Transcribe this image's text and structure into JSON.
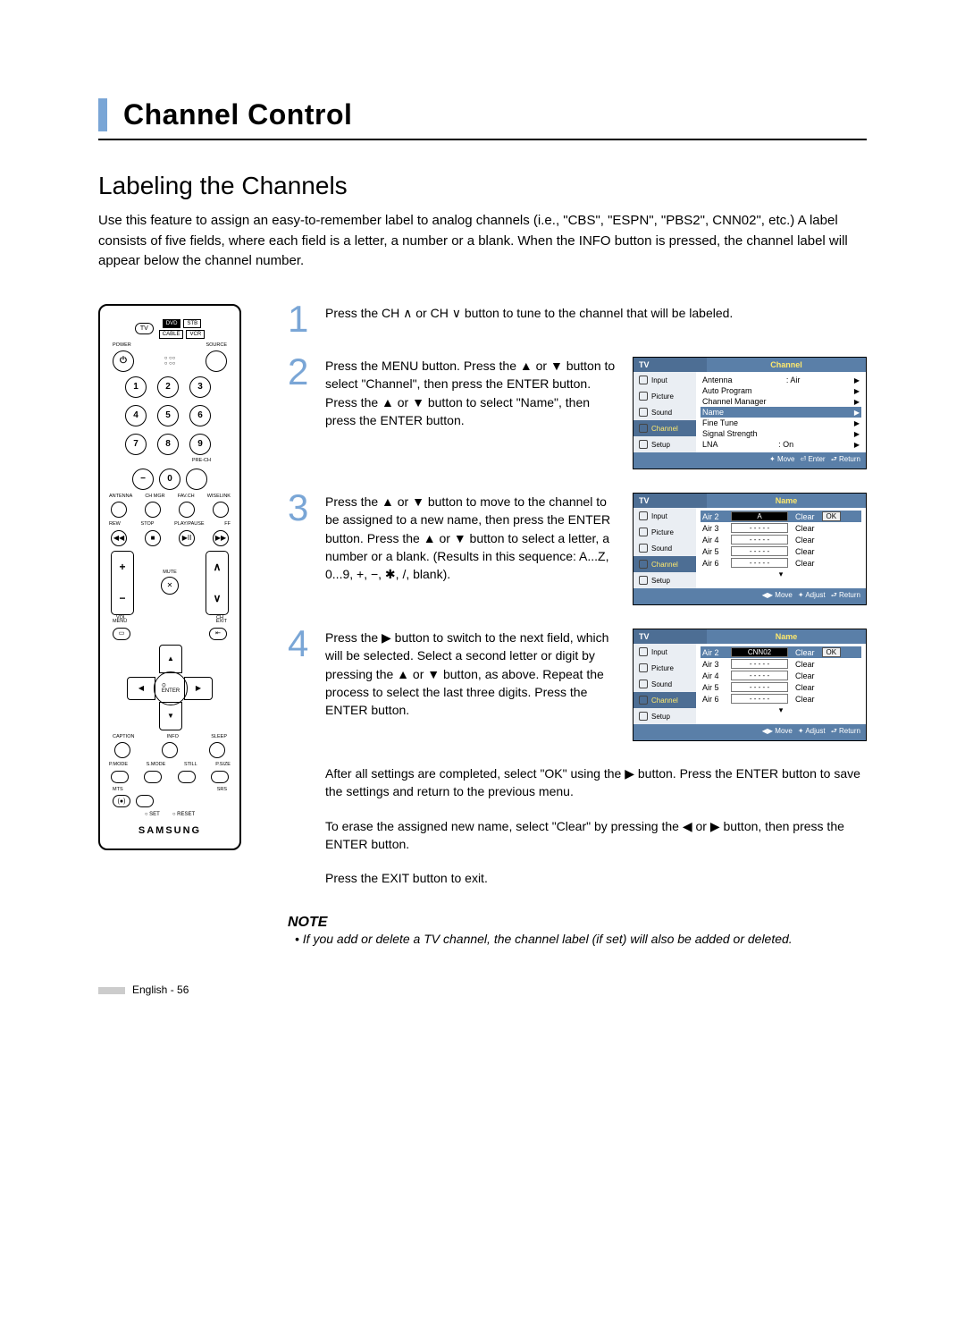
{
  "header": {
    "title": "Channel Control"
  },
  "section": {
    "title": "Labeling the Channels"
  },
  "intro": "Use this feature to assign an easy-to-remember label to analog channels (i.e., \"CBS\", \"ESPN\", \"PBS2\", CNN02\", etc.) A label consists of five fields, where each field is a letter, a number or a blank. When the INFO button is pressed, the channel label will appear below the channel number.",
  "steps": {
    "s1": "Press the CH ∧ or CH ∨ button to tune to the channel that will be labeled.",
    "s2": "Press the MENU button. Press the ▲ or ▼ button to select \"Channel\", then press the ENTER button. Press the ▲ or ▼ button to select \"Name\", then press the ENTER button.",
    "s3": "Press the ▲ or ▼ button to move to the channel to be assigned to a new name, then press the ENTER button. Press the ▲ or ▼ button to select a letter, a number or a blank. (Results in this sequence: A...Z, 0...9, +, −, ✱, /, blank).",
    "s4": "Press the ▶ button to switch to the next field, which will be selected. Select a second letter or digit by pressing the ▲ or ▼ button, as above. Repeat the process to select the last three digits. Press the ENTER button.",
    "after1": "After all settings are completed, select \"OK\" using the ▶ button. Press the ENTER button to save the settings and return to the previous menu.",
    "after2": "To erase the assigned new name, select \"Clear\" by pressing the ◀ or ▶ button, then press the ENTER button.",
    "after3": "Press the EXIT button to exit."
  },
  "note": {
    "head": "NOTE",
    "body": "• If you add or delete a TV channel, the channel label (if set) will also be added or deleted."
  },
  "footer": "English - 56",
  "osd": {
    "tv": "TV",
    "side": [
      "Input",
      "Picture",
      "Sound",
      "Channel",
      "Setup"
    ],
    "channel": {
      "title": "Channel",
      "rows": [
        {
          "l": "Antenna",
          "r": ": Air"
        },
        {
          "l": "Auto Program",
          "r": ""
        },
        {
          "l": "Channel Manager",
          "r": ""
        },
        {
          "l": "Name",
          "r": ""
        },
        {
          "l": "Fine Tune",
          "r": ""
        },
        {
          "l": "Signal Strength",
          "r": ""
        },
        {
          "l": "LNA",
          "r": ": On"
        }
      ],
      "foot": [
        "✦ Move",
        "⏎ Enter",
        "⮐ Return"
      ]
    },
    "name1": {
      "title": "Name",
      "rows": [
        {
          "ch": "Air   2",
          "val": "A",
          "clear": "Clear",
          "ok": "OK",
          "hl": true
        },
        {
          "ch": "Air   3",
          "val": "- - - - -",
          "clear": "Clear"
        },
        {
          "ch": "Air   4",
          "val": "- - - - -",
          "clear": "Clear"
        },
        {
          "ch": "Air   5",
          "val": "- - - - -",
          "clear": "Clear"
        },
        {
          "ch": "Air   6",
          "val": "- - - - -",
          "clear": "Clear"
        }
      ],
      "foot": [
        "◀▶ Move",
        "✦ Adjust",
        "⮐ Return"
      ]
    },
    "name2": {
      "title": "Name",
      "rows": [
        {
          "ch": "Air   2",
          "val": "CNN02",
          "clear": "Clear",
          "ok": "OK",
          "hl": true
        },
        {
          "ch": "Air   3",
          "val": "- - - - -",
          "clear": "Clear"
        },
        {
          "ch": "Air   4",
          "val": "- - - - -",
          "clear": "Clear"
        },
        {
          "ch": "Air   5",
          "val": "- - - - -",
          "clear": "Clear"
        },
        {
          "ch": "Air   6",
          "val": "- - - - -",
          "clear": "Clear"
        }
      ],
      "foot": [
        "◀▶ Move",
        "✦ Adjust",
        "⮐ Return"
      ]
    }
  },
  "remote": {
    "tv": "TV",
    "dvd": "DVD",
    "stb": "STB",
    "cable": "CABLE",
    "vcr": "VCR",
    "power": "POWER",
    "source": "SOURCE",
    "nums": [
      "1",
      "2",
      "3",
      "4",
      "5",
      "6",
      "7",
      "8",
      "9",
      "−",
      "0"
    ],
    "prech": "PRE-CH",
    "row_lbls": [
      "ANTENNA",
      "CH MGR",
      "FAV.CH",
      "WISELINK"
    ],
    "trans": [
      "REW",
      "STOP",
      "PLAY/PAUSE",
      "FF"
    ],
    "trans_sym": [
      "◀◀",
      "■",
      "▶II",
      "▶▶"
    ],
    "vol": "VOL",
    "ch": "CH",
    "mute": "MUTE",
    "menu": "MENU",
    "exit": "EXIT",
    "enter": "ENTER",
    "bot1": [
      "CAPTION",
      "INFO",
      "SLEEP"
    ],
    "bot2": [
      "P.MODE",
      "S.MODE",
      "STILL",
      "P.SIZE"
    ],
    "bot3": [
      "MTS",
      "SRS"
    ],
    "setreset": [
      "○ SET",
      "○ RESET"
    ],
    "logo": "SAMSUNG"
  }
}
